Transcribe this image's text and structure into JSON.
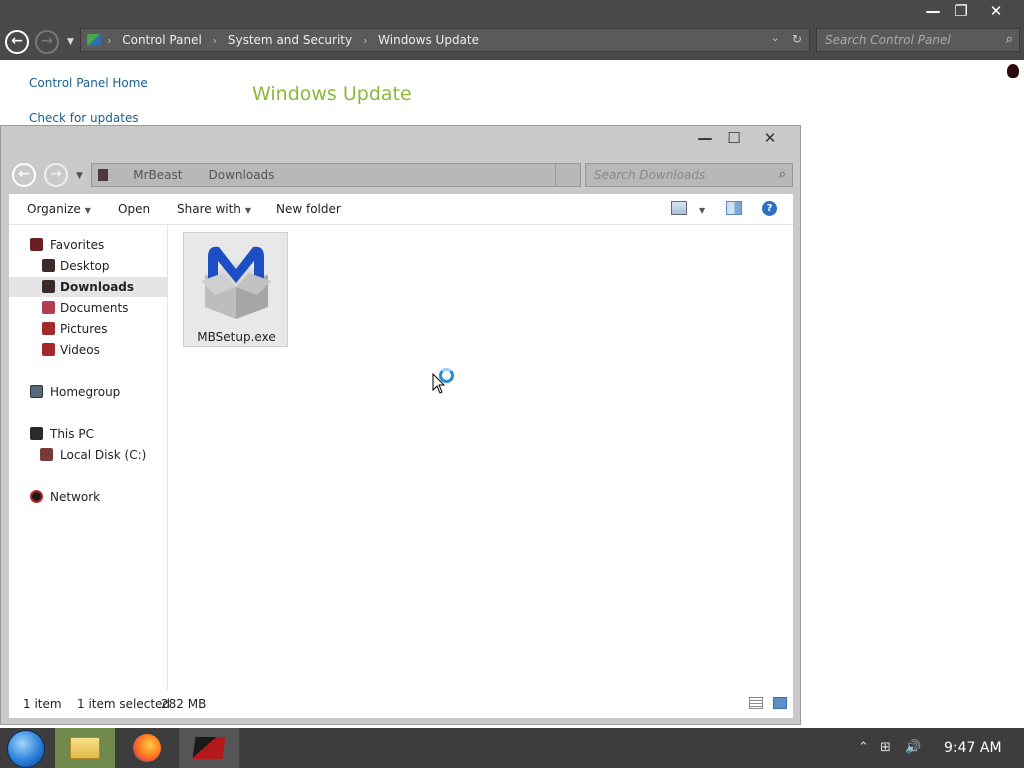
{
  "control_panel": {
    "breadcrumbs": [
      "Control Panel",
      "System and Security",
      "Windows Update"
    ],
    "search_placeholder": "Search Control Panel",
    "links": [
      "Control Panel Home",
      "Check for updates"
    ],
    "title": "Windows Update"
  },
  "explorer": {
    "breadcrumbs": [
      "MrBeast",
      "Downloads"
    ],
    "search_placeholder": "Search Downloads",
    "commands": [
      "Organize",
      "Open",
      "Share with",
      "New folder"
    ],
    "nav": {
      "favorites": "Favorites",
      "desktop": "Desktop",
      "downloads": "Downloads",
      "documents": "Documents",
      "pictures": "Pictures",
      "videos": "Videos",
      "homegroup": "Homegroup",
      "this_pc": "This PC",
      "local_disk": "Local Disk (C:)",
      "network": "Network"
    },
    "files": [
      {
        "name": "MBSetup.exe",
        "selected": true
      }
    ],
    "status": {
      "item_count": "1 item",
      "selection": "1 item selected",
      "size": "282 MB"
    }
  },
  "taskbar": {
    "clock": "9:47 AM",
    "apps": [
      "File Explorer",
      "Firefox",
      "Game"
    ]
  },
  "colors": {
    "title_green": "#8db63b",
    "link_blue": "#1a5f8e",
    "dark_chrome": "#4a4a4a",
    "malwarebytes_blue": "#1d4fc4"
  }
}
